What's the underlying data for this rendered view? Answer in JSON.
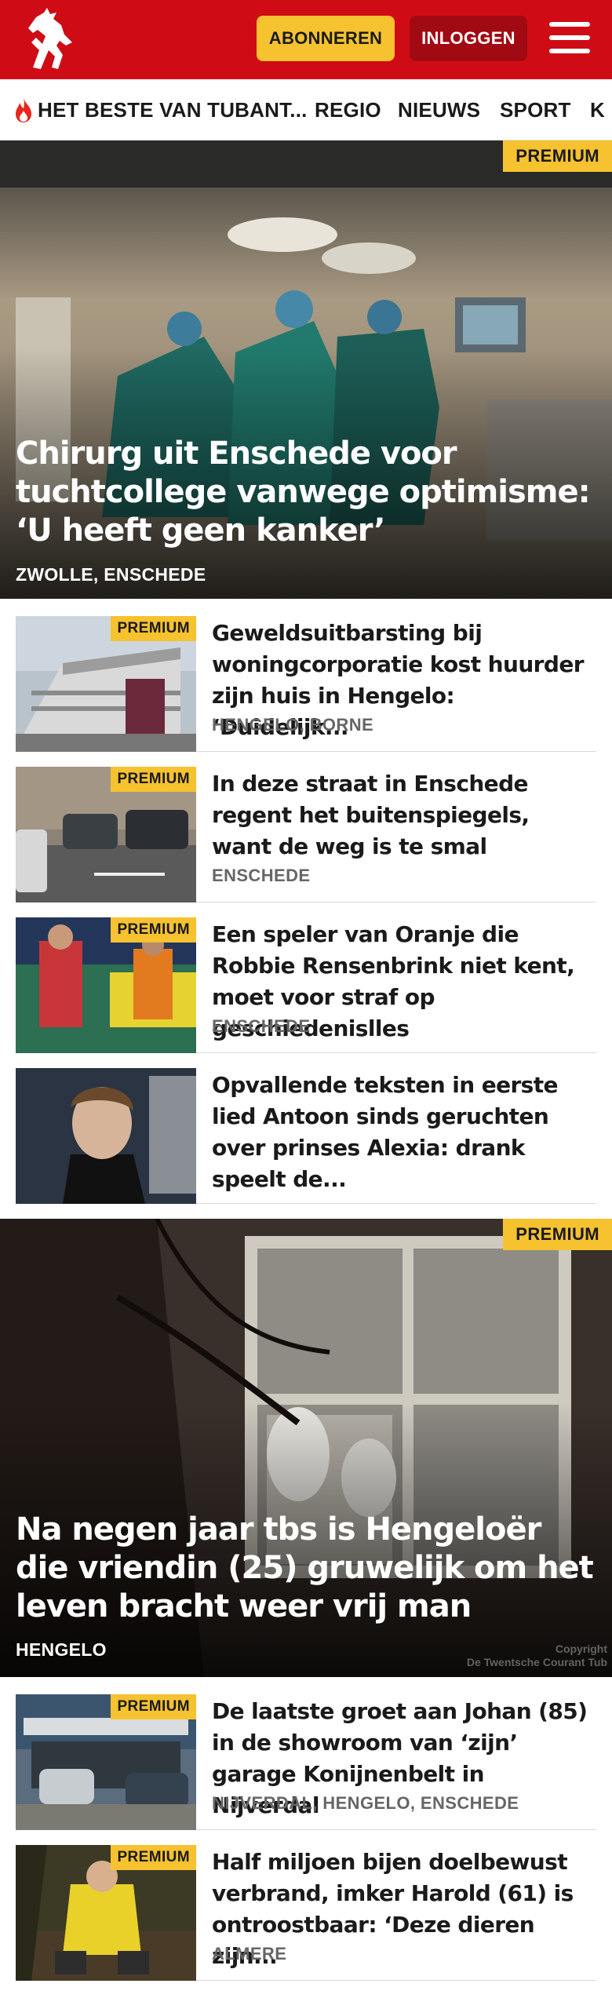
{
  "header": {
    "logo": "tubantia-horse-logo",
    "subscribe_label": "ABONNEREN",
    "login_label": "INLOGGEN",
    "menu_icon": "hamburger-menu-icon",
    "colors": {
      "brand_red": "#cf0c15",
      "subscribe_yellow": "#f6c22f",
      "login_dark_red": "#a10a12"
    }
  },
  "nav": {
    "items": [
      {
        "label": "HET BESTE VAN TUBANT...",
        "icon": "flame-icon"
      },
      {
        "label": "REGIO"
      },
      {
        "label": "NIEUWS"
      },
      {
        "label": "SPORT"
      },
      {
        "label": "K"
      }
    ]
  },
  "hero1": {
    "badge": "PREMIUM",
    "title": "Chirurg uit Enschede voor tuchtcolle­ge vanwege optimisme: ‘U heeft geen kanker’",
    "location": "ZWOLLE, ENSCHEDE"
  },
  "list1": [
    {
      "badge": "PREMIUM",
      "title": "Geweldsuitbarsting bij woningcorporatie kost huurder zijn huis in Hengelo: ‘Duidelijk...",
      "location": "HENGELO, BORNE"
    },
    {
      "badge": "PREMIUM",
      "title": "In deze straat in Enschede regent het buitenspiegels, want de weg is te smal",
      "location": "ENSCHEDE"
    },
    {
      "badge": "PREMIUM",
      "title": "Een speler van Oranje die Robbie Rensenbrink niet kent, moet voor straf op geschiedenislles",
      "location": "ENSCHEDE"
    },
    {
      "badge": "",
      "title": "Opvallende teksten in eerste lied Antoon sinds geruchten over prinses Alexia: drank speelt de...",
      "location": ""
    }
  ],
  "hero2": {
    "badge": "PREMIUM",
    "title": "Na negen jaar tbs is Hengeloër die vriendin (25) gruwelijk om het leven bracht weer vrij man",
    "location": "HENGELO",
    "copyright_line1": "Copyright",
    "copyright_line2": "De Twentsche Courant Tub"
  },
  "list2": [
    {
      "badge": "PREMIUM",
      "title": "De laatste groet aan Johan (85) in de showroom van ‘zijn’ garage Konijnenbelt in Nijverdal",
      "location": "NIJVERDAL, HENGELO, ENSCHEDE"
    },
    {
      "badge": "PREMIUM",
      "title": "Half miljoen bijen doelbewust verbrand, imker Harold (61) is ontroostbaar: ‘Deze dieren zijn...",
      "location": "ALMERE"
    }
  ]
}
